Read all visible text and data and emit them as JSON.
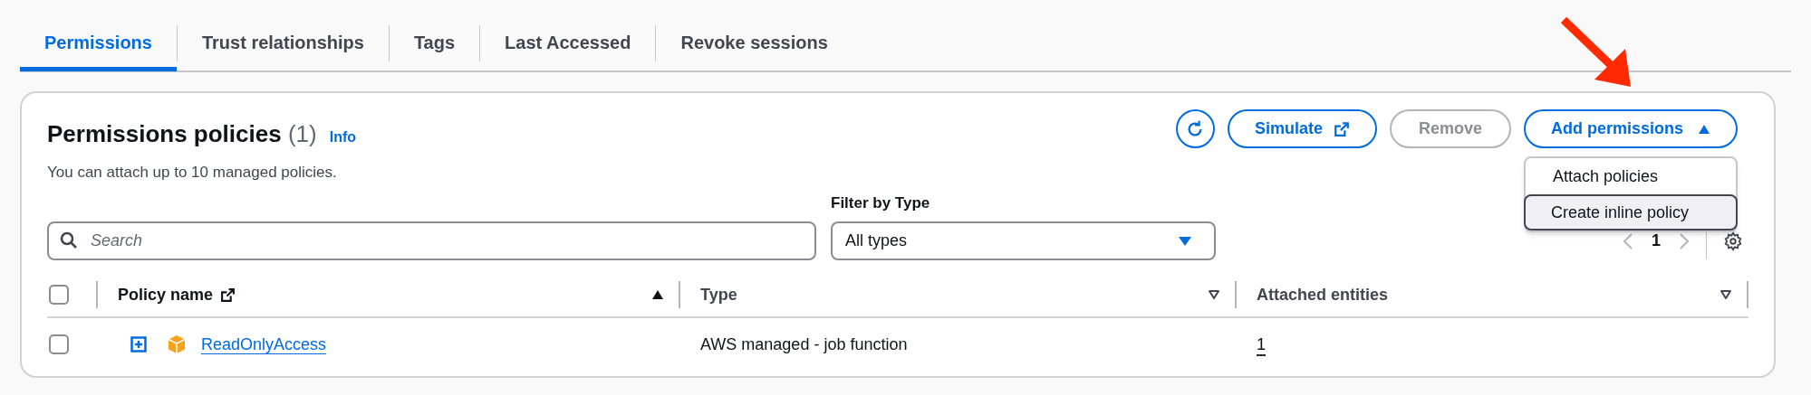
{
  "tabs": [
    {
      "label": "Permissions",
      "selected": true
    },
    {
      "label": "Trust relationships",
      "selected": false
    },
    {
      "label": "Tags",
      "selected": false
    },
    {
      "label": "Last Accessed",
      "selected": false
    },
    {
      "label": "Revoke sessions",
      "selected": false
    }
  ],
  "panel": {
    "title": "Permissions policies",
    "count": "(1)",
    "info": "Info",
    "description": "You can attach up to 10 managed policies.",
    "buttons": [
      {
        "kind": "refresh",
        "disabled": false
      },
      {
        "kind": "external",
        "label": "Simulate",
        "disabled": false
      },
      {
        "kind": "plain",
        "label": "Remove",
        "disabled": true
      },
      {
        "kind": "dropdown",
        "label": "Add permissions",
        "disabled": false,
        "expanded": true,
        "menu": [
          {
            "label": "Attach policies",
            "selected": false
          },
          {
            "label": "Create inline policy",
            "selected": true
          }
        ]
      }
    ],
    "search": {
      "placeholder": "Search"
    },
    "filter": {
      "label": "Filter by Type",
      "value": "All types"
    },
    "pagination": {
      "page": "1"
    },
    "table": {
      "all_checked": false,
      "columns": [
        {
          "label": "Policy name",
          "external": true,
          "sorted": true
        },
        {
          "label": "Type",
          "external": false,
          "sorted": false
        },
        {
          "label": "Attached entities",
          "external": false,
          "sorted": false
        }
      ],
      "rows": [
        {
          "checked": false,
          "expanded": false,
          "policy_name": "ReadOnlyAccess",
          "type": "AWS managed - job function",
          "attached_entities": "1"
        }
      ]
    }
  },
  "annotation": {
    "kind": "arrow",
    "color": "#ff2a00"
  }
}
